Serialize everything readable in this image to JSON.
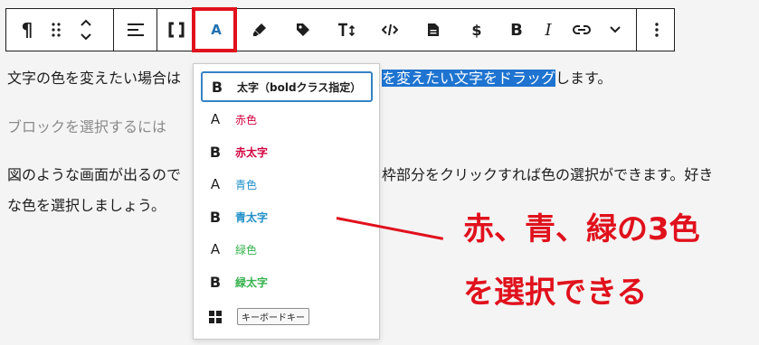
{
  "toolbar": {
    "paragraph_icon": "¶",
    "bold_label": "B",
    "italic_label": "I",
    "text_color_label": "A",
    "icons": [
      "pilcrow-icon",
      "drag-handle-icon",
      "move-up-down-icon",
      "align-icon",
      "brackets-icon",
      "text-color-icon",
      "highlighter-icon",
      "tag-icon",
      "text-size-icon",
      "code-icon",
      "document-icon",
      "dollar-icon",
      "bold-icon",
      "italic-icon",
      "link-icon",
      "chevron-down-icon",
      "more-options-icon"
    ]
  },
  "content": {
    "para1_before": "文字の色を変えたい場合は",
    "para1_selected": "を変えたい文字をドラッグ",
    "para1_after": "します。",
    "para2": "ブロックを選択するには",
    "para3_line1_left": "図のような画面が出るので",
    "para3_line1_right": "枠部分をクリックすれば色の選択ができます。好き",
    "para3_line2": "な色を選択しましょう。"
  },
  "dropdown": {
    "items": [
      {
        "icon": "B",
        "label": "太字（boldクラス指定）",
        "color": "#1e1e1e"
      },
      {
        "icon": "A",
        "label": "赤色",
        "color": "#d0033f"
      },
      {
        "icon": "B",
        "label": "赤太字",
        "color": "#d0033f"
      },
      {
        "icon": "A",
        "label": "青色",
        "color": "#1f8fc8"
      },
      {
        "icon": "B",
        "label": "青太字",
        "color": "#1f8fc8"
      },
      {
        "icon": "A",
        "label": "緑色",
        "color": "#37b24d"
      },
      {
        "icon": "B",
        "label": "緑太字",
        "color": "#37b24d"
      }
    ],
    "keyboard_label": "キーボードキー"
  },
  "annotation": {
    "line1": "赤、青、緑の3色",
    "line2": "を選択できる",
    "color": "#e0111c"
  }
}
